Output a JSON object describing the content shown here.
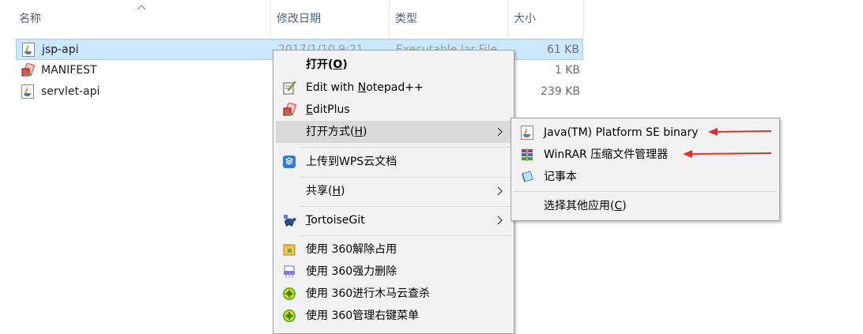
{
  "columns": {
    "name": "名称",
    "modified": "修改日期",
    "type": "类型",
    "size": "大小"
  },
  "files": [
    {
      "name": "jsp-api",
      "date": "2017/1/10 9:21",
      "type": "Executable Jar File",
      "size": "61 KB",
      "icon": "java-jar-icon",
      "selected": true
    },
    {
      "name": "MANIFEST",
      "date": "",
      "type": "",
      "size": "1 KB",
      "icon": "manifest-icon",
      "selected": false
    },
    {
      "name": "servlet-api",
      "date": "",
      "type": "",
      "size": "239 KB",
      "icon": "java-jar-icon",
      "selected": false
    }
  ],
  "context_menu": {
    "open": {
      "label": "打开(",
      "key": "O",
      "tail": ")"
    },
    "notepad": {
      "pre": "Edit with ",
      "key": "N",
      "post": "otepad++"
    },
    "editplus": {
      "key": "E",
      "post": "ditPlus"
    },
    "open_with": {
      "label": "打开方式(",
      "key": "H",
      "tail": ")"
    },
    "wps": "上传到WPS云文档",
    "share": {
      "label": "共享(",
      "key": "H",
      "tail": ")"
    },
    "tortoise": {
      "key": "T",
      "post": "ortoiseGit"
    },
    "unlock360": "使用 360解除占用",
    "delete360": "使用 360强力删除",
    "scan360": "使用 360进行木马云查杀",
    "menu360": "使用 360管理右键菜单"
  },
  "submenu": {
    "java": "Java(TM) Platform SE binary",
    "winrar": "WinRAR 压缩文件管理器",
    "notepad": "记事本",
    "other": {
      "label": "选择其他应用(",
      "key": "C",
      "tail": ")"
    }
  },
  "colors": {
    "selection": "#cce8ff",
    "menu_bg": "#f2f2f2",
    "annotation_arrow": "#e0302a"
  }
}
